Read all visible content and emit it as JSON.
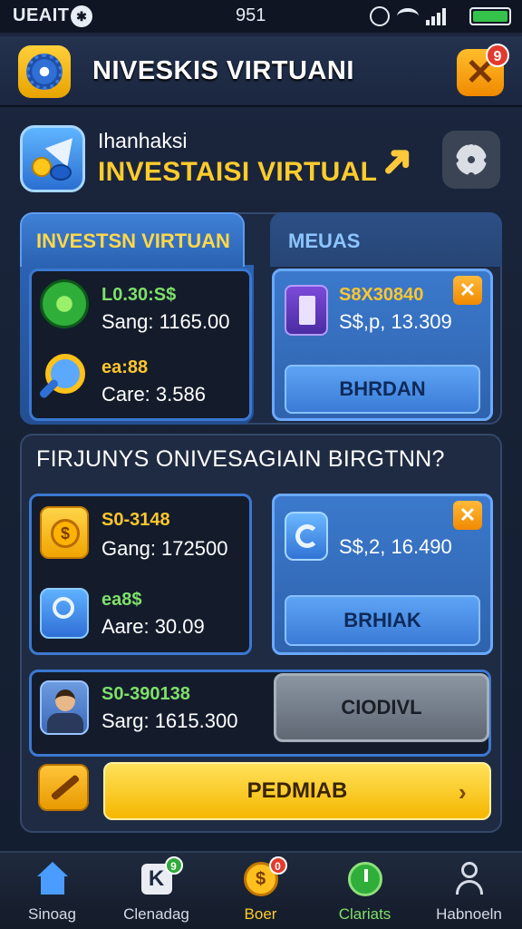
{
  "status_bar": {
    "carrier": "UEAIT",
    "time": "951"
  },
  "header": {
    "title": "NIVESKIS VIRTUANI",
    "close_badge": "9"
  },
  "app": {
    "subtitle": "Ihanhaksi",
    "title": "INVESTAISI VIRTUAL"
  },
  "panel_a": {
    "tab_left": "INVESTSN VIRTUAN",
    "tab_right": "MEUAS",
    "card_left": {
      "line1": "L0.30:S$",
      "line2": "Sang: 1165.00",
      "line3": "ea:88",
      "line4": "Care: 3.586"
    },
    "card_right": {
      "line1": "S8X30840",
      "line2": "S$,p, 13.309",
      "button": "BHRDAN"
    }
  },
  "panel_b": {
    "question": "FIRJUNYS ONIVESAGIAIN BIRGTNN?",
    "card_left": {
      "line1": "S0-3148",
      "line2": "Gang: 172500",
      "line3": "ea8$",
      "line4": "Aare: 30.09"
    },
    "card_right": {
      "line1": "S$,2, 16.490",
      "button": "BRHIAK"
    },
    "row": {
      "line1": "S0-390138",
      "line2": "Sarg: 1615.300",
      "button": "CIODIVL"
    },
    "cta": "PEDMIAB"
  },
  "bottom_nav": [
    {
      "label": "Sinoag",
      "icon": "home-icon"
    },
    {
      "label": "Clenadag",
      "icon": "chart-icon",
      "badge": "9"
    },
    {
      "label": "Boer",
      "icon": "coin-icon",
      "badge": "0"
    },
    {
      "label": "Clariats",
      "icon": "clock-icon"
    },
    {
      "label": "Habnoeln",
      "icon": "profile-icon"
    }
  ],
  "colors": {
    "accent_gold": "#ffcc2c",
    "accent_blue": "#3b78d0",
    "green": "#7fe06a"
  }
}
